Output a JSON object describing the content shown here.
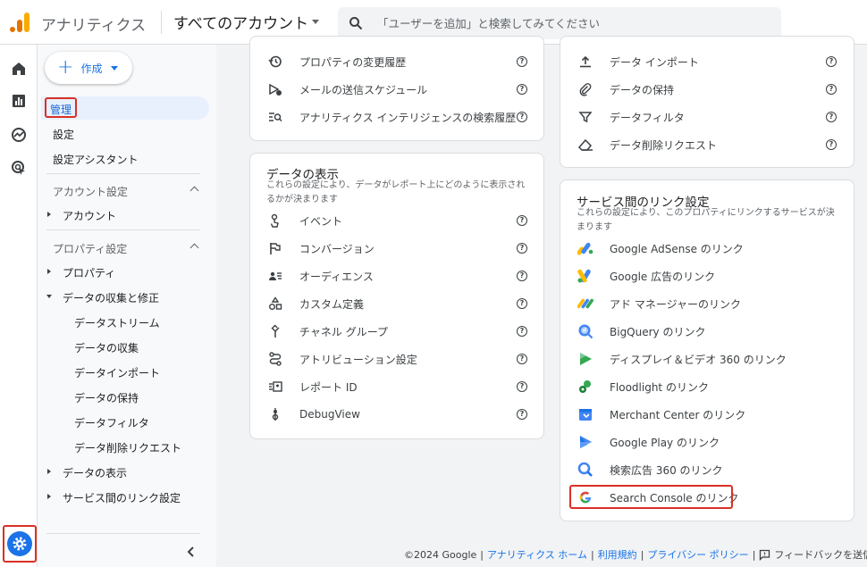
{
  "header": {
    "app_title": "アナリティクス",
    "account_label": "すべてのアカウント",
    "search_placeholder": "「ユーザーを追加」と検索してみてください"
  },
  "sidebar": {
    "create_label": "作成",
    "admin_label": "管理",
    "settings_label": "設定",
    "setup_assistant_label": "設定アシスタント",
    "account_section": "アカウント設定",
    "account_item": "アカウント",
    "property_section": "プロパティ設定",
    "property_item": "プロパティ",
    "data_collection": "データの収集と修正",
    "data_collection_children": [
      "データストリーム",
      "データの収集",
      "データインポート",
      "データの保持",
      "データフィルタ",
      "データ削除リクエスト"
    ],
    "data_display": "データの表示",
    "service_links": "サービス間のリンク設定"
  },
  "top_left_card": {
    "items": [
      "プロパティの変更履歴",
      "メールの送信スケジュール",
      "アナリティクス インテリジェンスの検索履歴"
    ]
  },
  "top_right_card": {
    "items": [
      "データ インポート",
      "データの保持",
      "データフィルタ",
      "データ削除リクエスト"
    ]
  },
  "display_card": {
    "title": "データの表示",
    "desc": "これらの設定により、データがレポート上にどのように表示されるかが決まります",
    "items": [
      "イベント",
      "コンバージョン",
      "オーディエンス",
      "カスタム定義",
      "チャネル グループ",
      "アトリビューション設定",
      "レポート ID",
      "DebugView"
    ]
  },
  "links_card": {
    "title": "サービス間のリンク設定",
    "desc": "これらの設定により、このプロパティにリンクするサービスが決まります",
    "items": [
      "Google AdSense のリンク",
      "Google 広告のリンク",
      "アド マネージャーのリンク",
      "BigQuery のリンク",
      "ディスプレイ＆ビデオ 360 のリンク",
      "Floodlight のリンク",
      "Merchant Center のリンク",
      "Google Play のリンク",
      "検索広告 360 のリンク",
      "Search Console のリンク"
    ]
  },
  "footer": {
    "copyright": "©2024 Google",
    "home": "アナリティクス ホーム",
    "terms": "利用規約",
    "privacy": "プライバシー ポリシー",
    "feedback": "フィードバックを送信"
  },
  "help_glyph": "?",
  "colors": {
    "accent": "#1a73e8",
    "highlight": "#d93025",
    "selected_bg": "#e8f0fe"
  }
}
